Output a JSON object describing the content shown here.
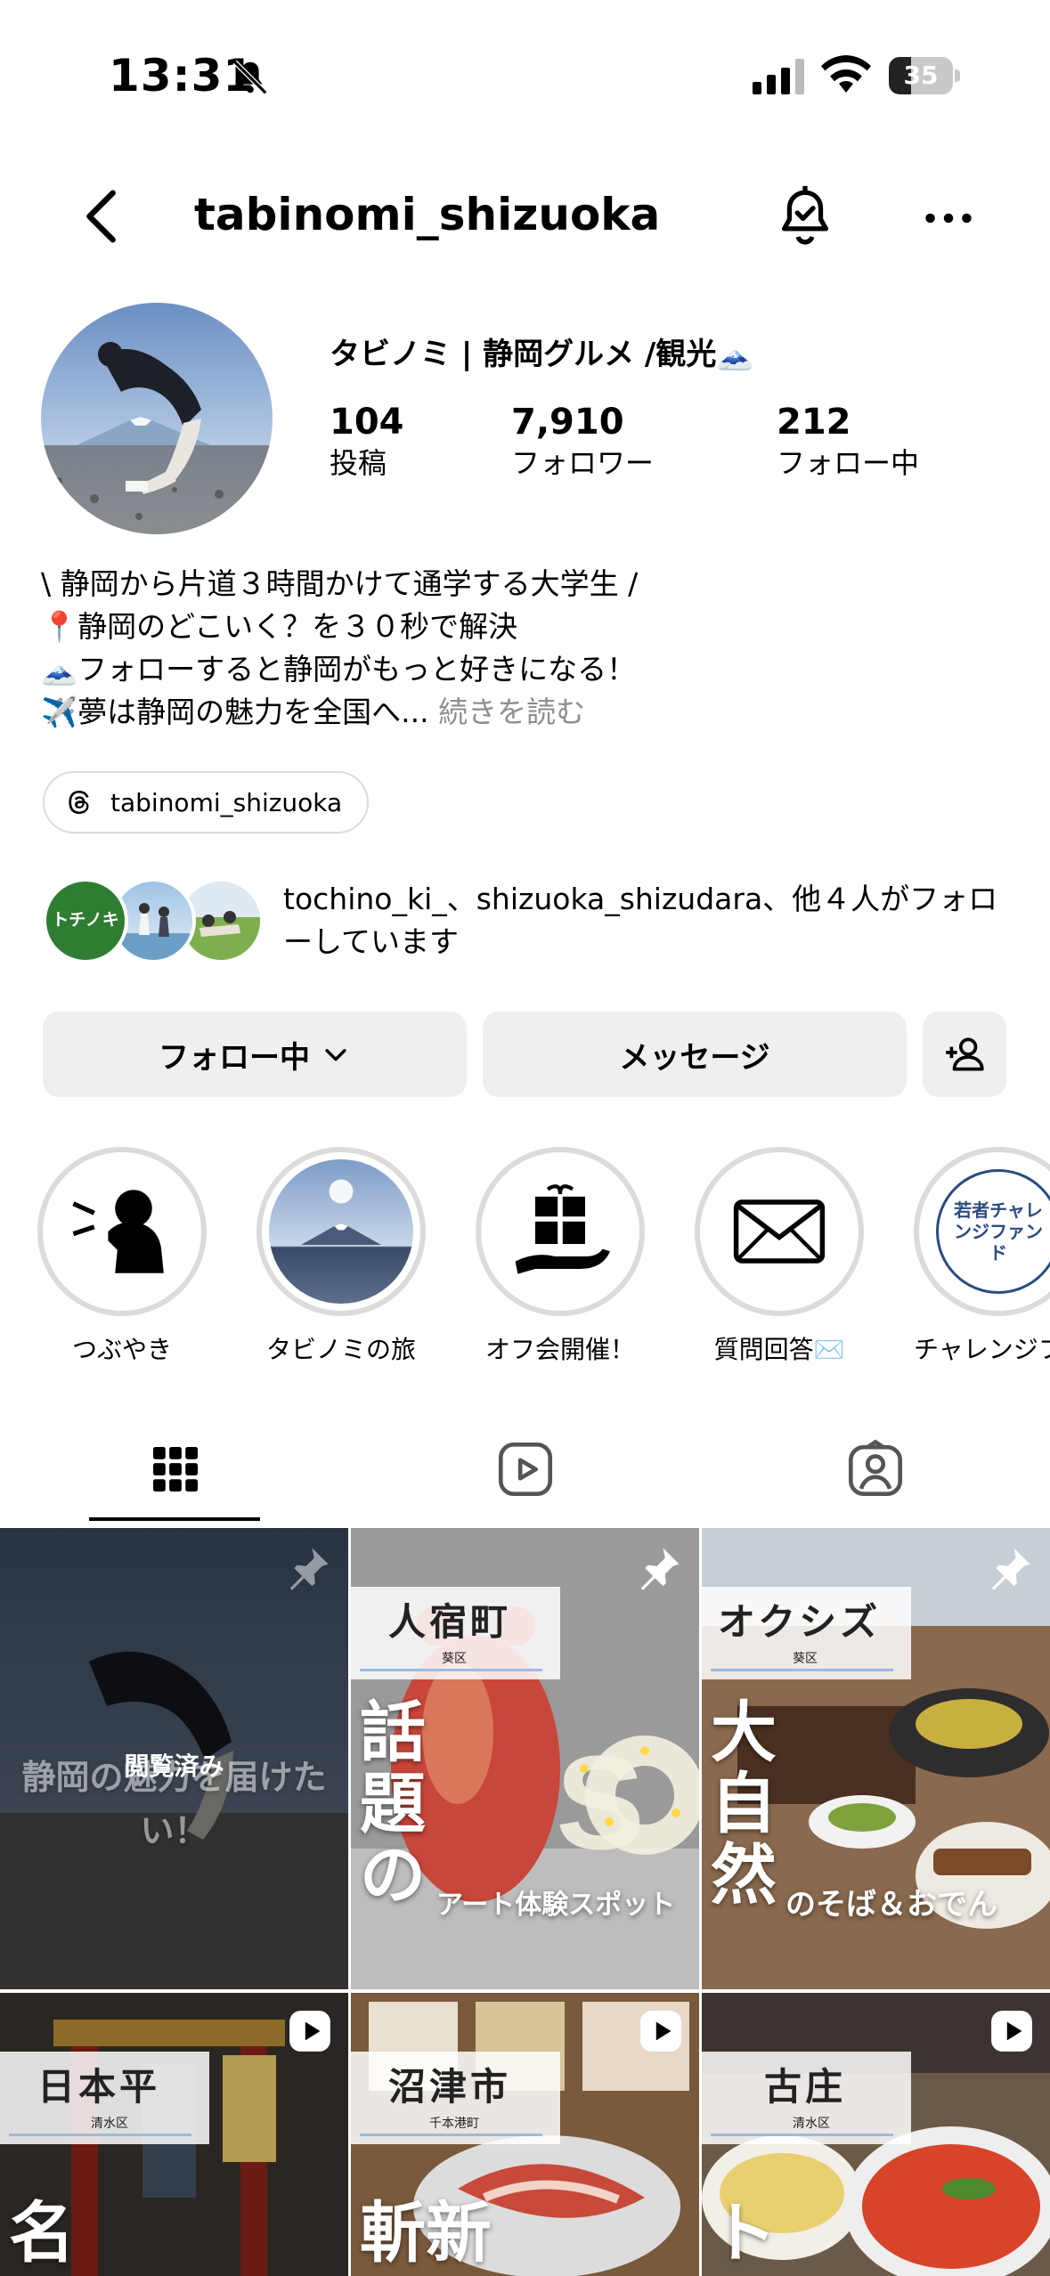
{
  "status_bar": {
    "time": "13:31",
    "battery": "35",
    "battery_level": 0.35
  },
  "header": {
    "username": "tabinomi_shizuoka"
  },
  "profile": {
    "display_name": "タビノミ | 静岡グルメ /観光🗻",
    "stats": [
      {
        "value": "104",
        "label": "投稿"
      },
      {
        "value": "7,910",
        "label": "フォロワー"
      },
      {
        "value": "212",
        "label": "フォロー中"
      }
    ],
    "bio": [
      "\\ 静岡から片道３時間かけて通学する大学生 /",
      "📍静岡のどこいく？を３０秒で解決",
      "🗻フォローすると静岡がもっと好きになる！",
      "✈️夢は静岡の魅力を全国へ..."
    ],
    "more_label": "続きを読む",
    "threads_handle": "tabinomi_shizuoka",
    "mutuals_text": "tochino_ki_、shizuoka_shizudara、他４人がフォローしています",
    "mutual_badge": "トチノキ"
  },
  "actions": {
    "following": "フォロー中",
    "message": "メッセージ"
  },
  "highlights": [
    {
      "label": "つぶやき"
    },
    {
      "label": "タビノミの旅"
    },
    {
      "label": "オフ会開催！"
    },
    {
      "label": "質問回答✉️"
    },
    {
      "label": "チャレンジフ",
      "badge": "若者チャレンジファンド"
    }
  ],
  "grid": {
    "tile1": {
      "caption": "静岡の魅力を届けたい！",
      "seen": "閲覧済み"
    },
    "tile2": {
      "place": "人宿町",
      "sub": "葵区",
      "big": "話題の",
      "small": "アート体験スポット"
    },
    "tile3": {
      "place": "オクシズ",
      "sub": "葵区",
      "big": "大自然",
      "small": "のそば＆おでん"
    },
    "tile4": {
      "place": "日本平",
      "sub": "清水区",
      "big": "名"
    },
    "tile5": {
      "place": "沼津市",
      "sub": "千本港町",
      "big": "斬新"
    },
    "tile6": {
      "place": "古庄",
      "sub": "清水区",
      "big": "ト"
    }
  },
  "colors": {
    "button_bg": "#efefef",
    "muted": "#8e8e8e",
    "ring": "#dbdbdb"
  }
}
